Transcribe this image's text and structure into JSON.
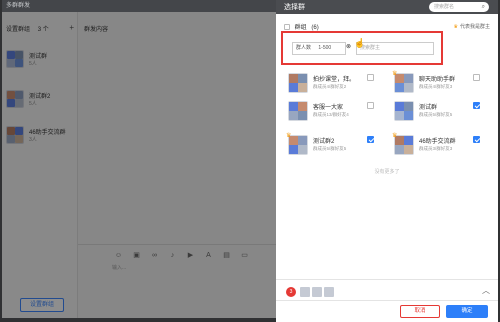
{
  "window": {
    "title": "多群群发"
  },
  "left": {
    "header": "设置群组",
    "header_count": "3 个",
    "add_icon": "plus-icon",
    "groups": [
      {
        "name": "测试群",
        "count": "5人"
      },
      {
        "name": "测试群2",
        "count": "5人"
      },
      {
        "name": "46助手交流群",
        "count": "3人"
      }
    ],
    "settings_button": "设置群组"
  },
  "middle": {
    "header": "群发内容",
    "input_placeholder": "输入..."
  },
  "dialog": {
    "title": "选择群",
    "search_placeholder": "搜索群名",
    "tab_label": "群组",
    "tab_count": "(6)",
    "owner_note": "代表我是群主",
    "filter": {
      "count_label": "群人数",
      "count_value": "1-500",
      "owner_placeholder": "搜索群主"
    },
    "cards": [
      {
        "name": "拍抄课堂，拜。",
        "sub": "群成员4/群好友2",
        "checked": false,
        "crown": false
      },
      {
        "name": "聊天助助手群",
        "sub": "群成员4/群好友3",
        "checked": false,
        "crown": true
      },
      {
        "name": "客服一大家",
        "sub": "群成员13/群好友4",
        "checked": false,
        "crown": false
      },
      {
        "name": "测试群",
        "sub": "群成员5/群好友5",
        "checked": true,
        "crown": false
      },
      {
        "name": "测试群2",
        "sub": "群成员5/群好友5",
        "checked": true,
        "crown": true
      },
      {
        "name": "46助手交流群",
        "sub": "群成员3/群好友3",
        "checked": true,
        "crown": true
      }
    ],
    "no_more": "没有更多了",
    "selected_count": "3",
    "cancel": "取消",
    "confirm": "确定"
  },
  "colors": {
    "accent": "#2d7ff9",
    "highlight": "#e53935",
    "crown": "#f39c12"
  }
}
